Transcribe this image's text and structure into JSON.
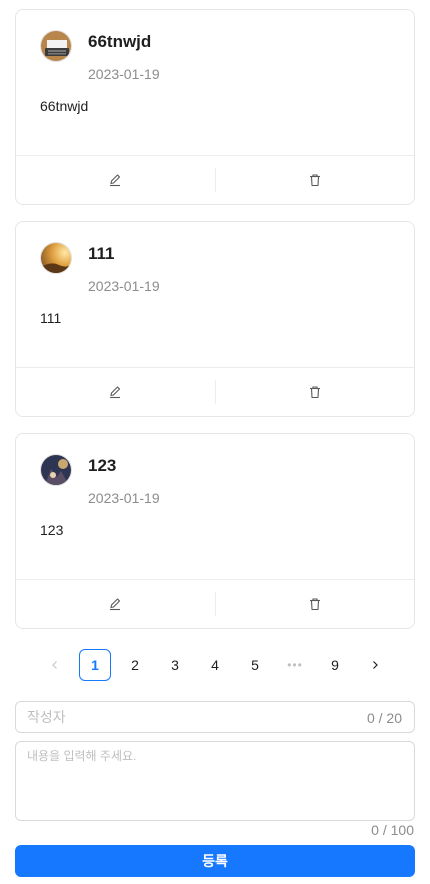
{
  "comments": [
    {
      "author": "66tnwjd",
      "date": "2023-01-19",
      "content": "66tnwjd",
      "avatar": "typewriter-avatar"
    },
    {
      "author": "111",
      "date": "2023-01-19",
      "content": "111",
      "avatar": "sunset-avatar"
    },
    {
      "author": "123",
      "date": "2023-01-19",
      "content": "123",
      "avatar": "night-scene-avatar"
    }
  ],
  "actions": {
    "edit_icon": "edit-icon",
    "delete_icon": "delete-icon"
  },
  "pagination": {
    "prev_icon": "chevron-left-icon",
    "pages": [
      "1",
      "2",
      "3",
      "4",
      "5"
    ],
    "ellipsis": "•••",
    "last": "9",
    "next_icon": "chevron-right-icon",
    "current": "1"
  },
  "form": {
    "writer_placeholder": "작성자",
    "writer_count": "0 / 20",
    "content_placeholder": "내용을 입력해 주세요.",
    "content_count": "0 / 100",
    "submit_label": "등록"
  },
  "colors": {
    "accent": "#1677ff",
    "border": "#d9d9d9",
    "muted": "#8c8c8c"
  }
}
